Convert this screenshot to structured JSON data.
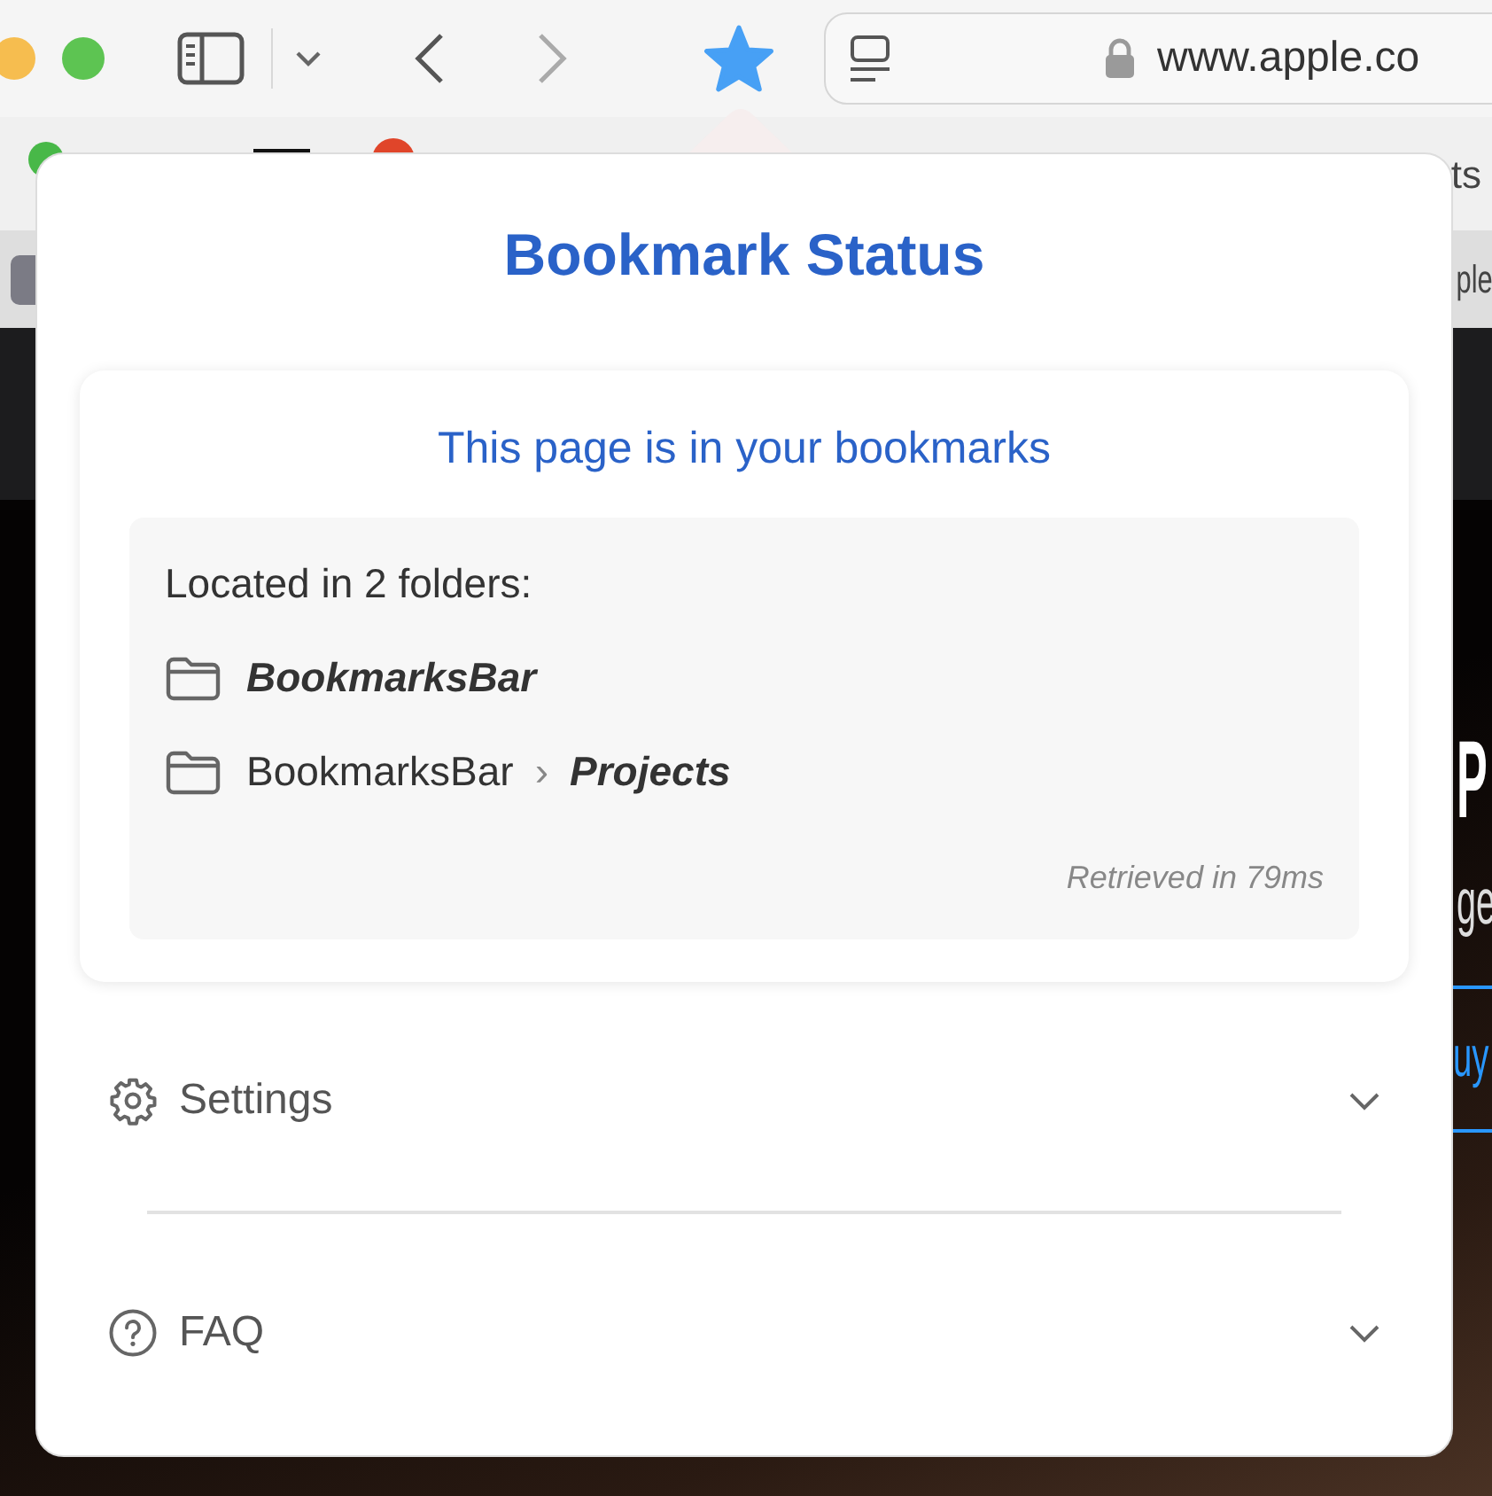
{
  "toolbar": {
    "url": "www.apple.co",
    "bookmarked": true
  },
  "bookmarks_bar": {
    "item_text": "ts"
  },
  "tab_bar": {
    "tab_text": "ple"
  },
  "page": {
    "headline": "P",
    "subline": "ge",
    "link": "uy"
  },
  "popup": {
    "title": "Bookmark Status",
    "status": "This page is in your bookmarks",
    "located": "Located in 2 folders:",
    "separator": "›",
    "folders": [
      {
        "path": [
          "BookmarksBar"
        ]
      },
      {
        "path": [
          "BookmarksBar",
          "Projects"
        ]
      }
    ],
    "retrieved": "Retrieved in 79ms",
    "sections": [
      {
        "label": "Settings",
        "expanded": false
      },
      {
        "label": "FAQ",
        "expanded": false
      }
    ]
  }
}
